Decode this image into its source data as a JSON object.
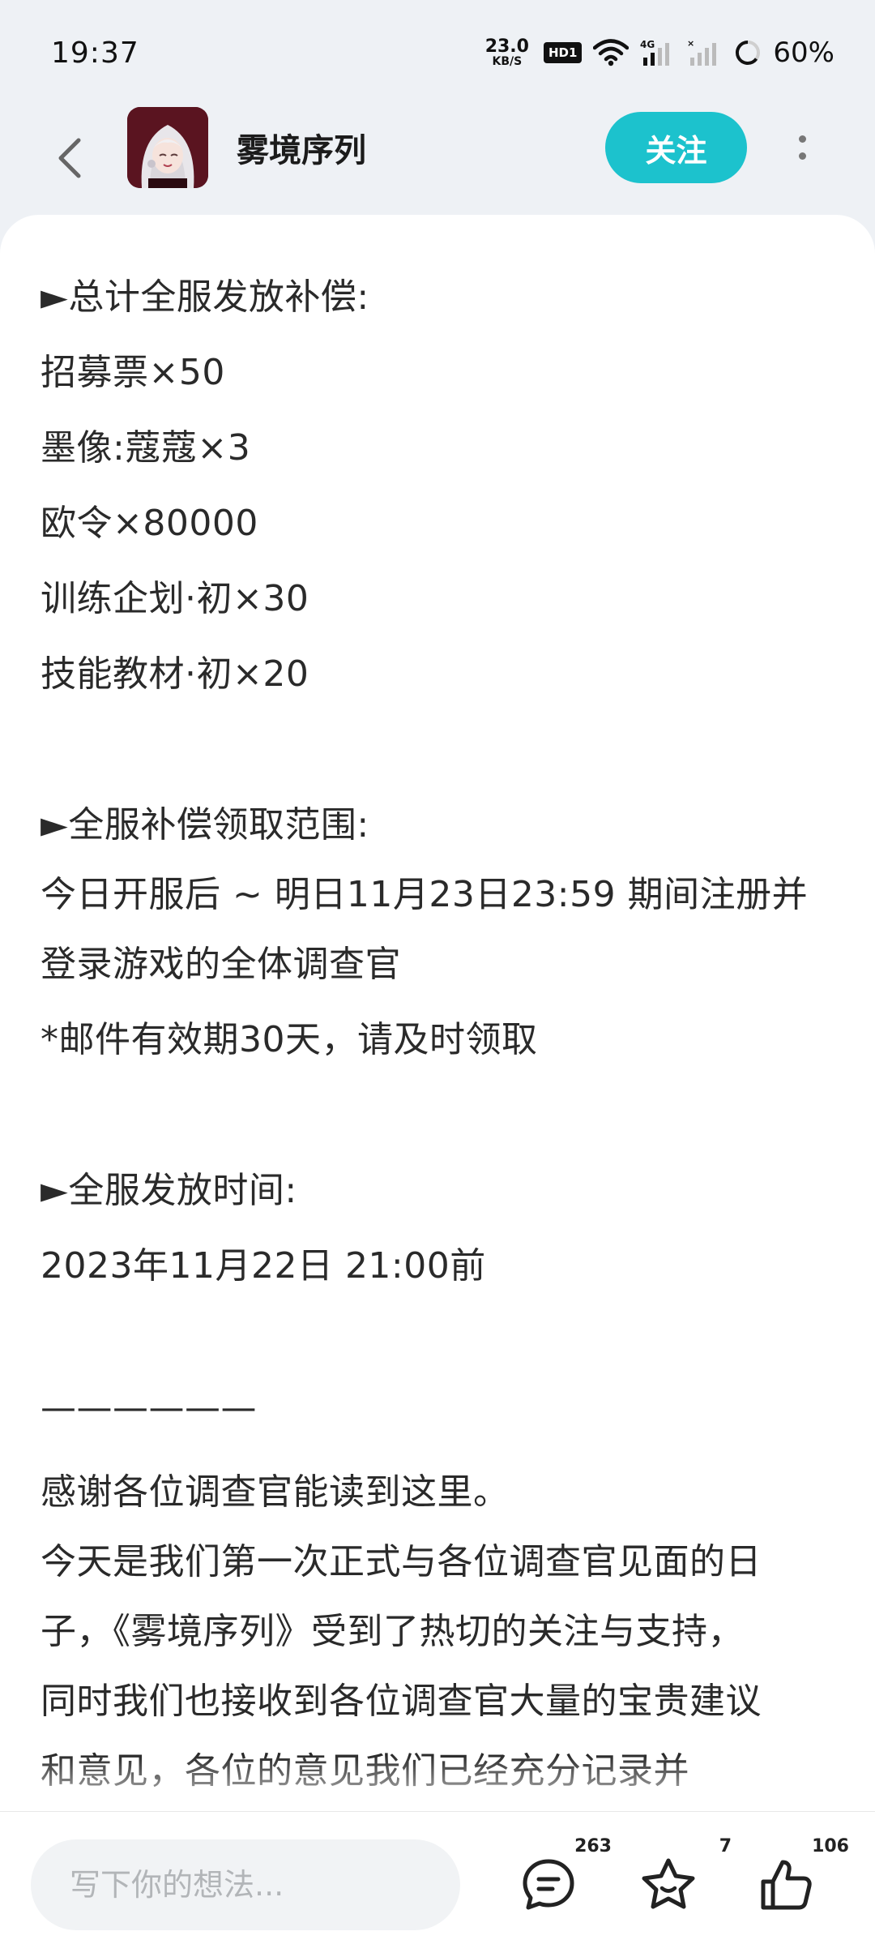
{
  "status_bar": {
    "time": "19:37",
    "net_speed_value": "23.0",
    "net_speed_unit": "KB/S",
    "hd_label": "HD1",
    "battery": "60%"
  },
  "header": {
    "title": "雾境序列",
    "follow_label": "关注"
  },
  "content": {
    "lines": [
      "►总计全服发放补偿:",
      "招募票×50",
      "墨像:蔻蔻×3",
      "欧令×80000",
      "训练企划·初×30",
      "技能教材·初×20",
      "",
      "►全服补偿领取范围:",
      "今日开服后 ~ 明日11月23日23:59 期间注册并",
      "登录游戏的全体调查官",
      "*邮件有效期30天，请及时领取",
      "",
      "►全服发放时间:",
      "2023年11月22日 21:00前",
      "",
      "——————",
      "感谢各位调查官能读到这里。",
      "今天是我们第一次正式与各位调查官见面的日",
      "子，《雾境序列》受到了热切的关注与支持，",
      "同时我们也接收到各位调查官大量的宝贵建议",
      "和意见，各位的意见我们已经充分记录并"
    ]
  },
  "bottom_bar": {
    "comment_placeholder": "写下你的想法...",
    "comment_count": "263",
    "favorite_count": "7",
    "like_count": "106"
  },
  "colors": {
    "accent": "#1cc2cd",
    "background": "#eef1f5",
    "card": "#ffffff"
  },
  "icons": {
    "back": "back-arrow-icon",
    "more": "more-vertical-icon",
    "comment": "comment-bubble-icon",
    "favorite": "star-icon",
    "like": "thumbs-up-icon"
  }
}
